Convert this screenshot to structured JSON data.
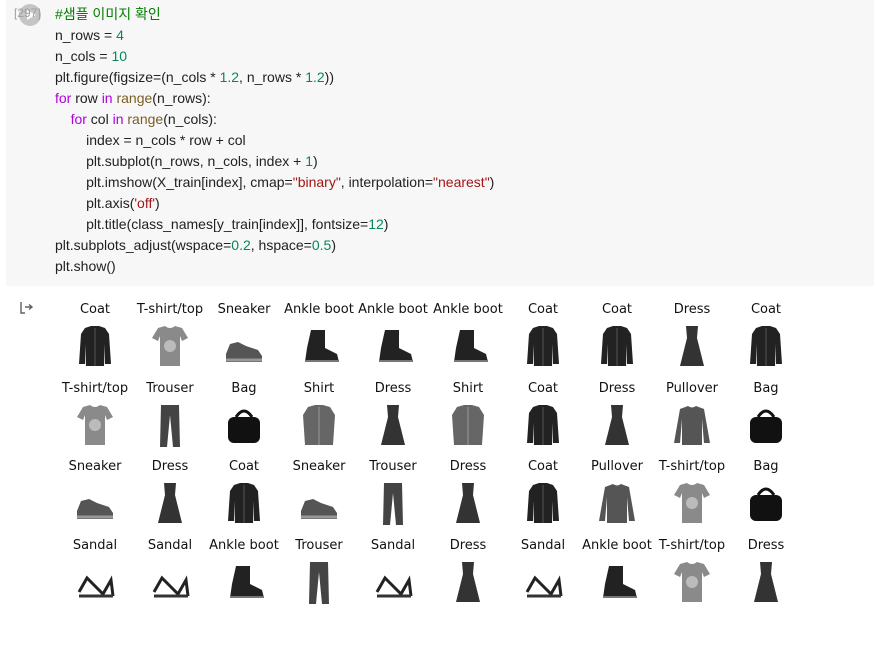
{
  "cell": {
    "execution_count": "[297]",
    "lines": [
      [
        {
          "t": "#샘플 이미지 확인",
          "c": "cm"
        }
      ],
      [
        {
          "t": "n_rows = "
        },
        {
          "t": "4",
          "c": "nm"
        }
      ],
      [
        {
          "t": "n_cols = "
        },
        {
          "t": "10",
          "c": "nm"
        }
      ],
      [
        {
          "t": "plt.figure(figsize=(n_cols * "
        },
        {
          "t": "1.2",
          "c": "nm"
        },
        {
          "t": ", n_rows * "
        },
        {
          "t": "1.2",
          "c": "nm"
        },
        {
          "t": "))"
        }
      ],
      [
        {
          "t": "for",
          "c": "kw"
        },
        {
          "t": " row "
        },
        {
          "t": "in",
          "c": "kw"
        },
        {
          "t": " "
        },
        {
          "t": "range",
          "c": "bi"
        },
        {
          "t": "(n_rows):"
        }
      ],
      [
        {
          "t": "    "
        },
        {
          "t": "for",
          "c": "kw"
        },
        {
          "t": " col "
        },
        {
          "t": "in",
          "c": "kw"
        },
        {
          "t": " "
        },
        {
          "t": "range",
          "c": "bi"
        },
        {
          "t": "(n_cols):"
        }
      ],
      [
        {
          "t": "        index = n_cols * row + col"
        }
      ],
      [
        {
          "t": "        plt.subplot(n_rows, n_cols, index + "
        },
        {
          "t": "1",
          "c": "nm"
        },
        {
          "t": ")"
        }
      ],
      [
        {
          "t": "        plt.imshow(X_train[index], cmap="
        },
        {
          "t": "\"binary\"",
          "c": "st"
        },
        {
          "t": ", interpolation="
        },
        {
          "t": "\"nearest\"",
          "c": "st"
        },
        {
          "t": ")"
        }
      ],
      [
        {
          "t": "        plt.axis("
        },
        {
          "t": "'off'",
          "c": "st"
        },
        {
          "t": ")"
        }
      ],
      [
        {
          "t": "        plt.title(class_names[y_train[index]], fontsize="
        },
        {
          "t": "12",
          "c": "nm"
        },
        {
          "t": ")"
        }
      ],
      [
        {
          "t": "plt.subplots_adjust(wspace="
        },
        {
          "t": "0.2",
          "c": "nm"
        },
        {
          "t": ", hspace="
        },
        {
          "t": "0.5",
          "c": "nm"
        },
        {
          "t": ")"
        }
      ],
      [
        {
          "t": "plt.show()"
        }
      ]
    ]
  },
  "output": {
    "icon": "output-arrow-icon",
    "labels": [
      [
        "Coat",
        "T-shirt/top",
        "Sneaker",
        "Ankle boot",
        "Ankle boot",
        "Ankle boot",
        "Coat",
        "Coat",
        "Dress",
        "Coat"
      ],
      [
        "T-shirt/top",
        "Trouser",
        "Bag",
        "Shirt",
        "Dress",
        "Shirt",
        "Coat",
        "Dress",
        "Pullover",
        "Bag"
      ],
      [
        "Sneaker",
        "Dress",
        "Coat",
        "Sneaker",
        "Trouser",
        "Dress",
        "Coat",
        "Pullover",
        "T-shirt/top",
        "Bag"
      ],
      [
        "Sandal",
        "Sandal",
        "Ankle boot",
        "Trouser",
        "Sandal",
        "Dress",
        "Sandal",
        "Ankle boot",
        "T-shirt/top",
        "Dress"
      ]
    ]
  },
  "colors": {
    "cell_bg": "#f7f7f7",
    "comment": "#008000",
    "keyword": "#af00db",
    "builtin": "#795e26",
    "number": "#098658",
    "string": "#a31515"
  }
}
